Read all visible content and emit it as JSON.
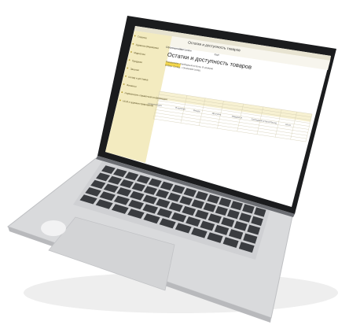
{
  "colors": {
    "background": "#ffffff",
    "laptop_body": "#d6d7d9",
    "bezel": "#1b1c1e",
    "keys": "#3a3c40",
    "sidebar": "#f3ebc0",
    "accent_yellow": "#f5d84a",
    "screen": "#ffffff",
    "table_header": "#f7f1d2"
  },
  "app": {
    "window_title": "Остатки и доступность товаров",
    "report_title": "Остатки и доступность товаров",
    "generate_button": "Сформировать",
    "toolbar": {
      "settings": "Настройки",
      "more": "Ещё"
    },
    "params": [
      "Показатели: Свободный остаток, В резерве",
      "Отбор: Склад = Основной склад"
    ],
    "sidebar_items": [
      "Главное",
      "Администрирование",
      "Маркетинг",
      "Продажи",
      "Закупки",
      "Склад и доставка",
      "Финансы",
      "Нормативно-справочная информация",
      "НСИ и администрирование"
    ],
    "columns": [
      "Номенклатура",
      "В наличии",
      "Резерв",
      "Доступно",
      "Ожидается",
      "Свободный остаток",
      "Расход",
      "Итого"
    ]
  }
}
